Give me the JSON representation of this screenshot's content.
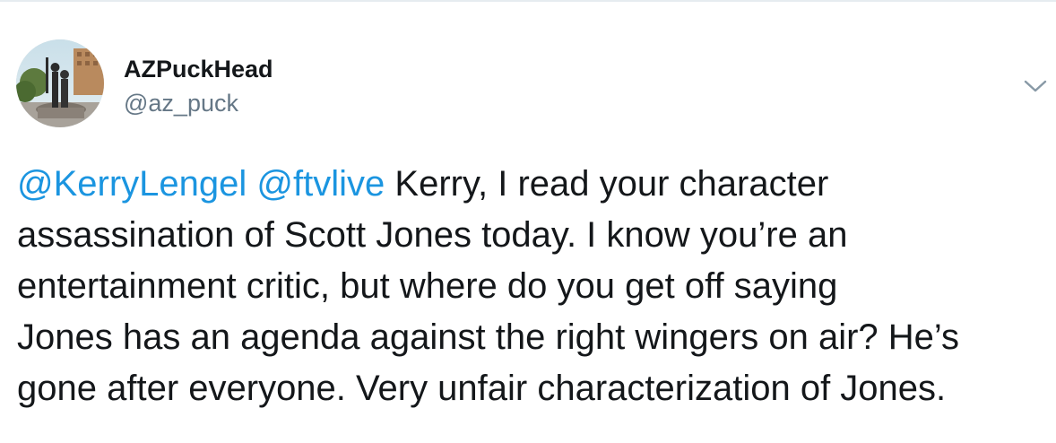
{
  "tweet": {
    "author": {
      "display_name": "AZPuckHead",
      "handle": "@az_puck",
      "avatar_icon": "statue-avatar-photo"
    },
    "menu_icon": "chevron-down-icon",
    "mentions": [
      "@KerryLengel",
      "@ftvlive"
    ],
    "text_lines": [
      "Kerry, I read your character",
      "assassination of Scott Jones today. I know you’re an",
      "entertainment critic, but where do you get off saying",
      "Jones has an agenda against the right wingers on air? He’s",
      "gone after everyone. Very unfair characterization of Jones."
    ]
  },
  "colors": {
    "link": "#1b95e0",
    "text": "#14171a",
    "secondary": "#657786",
    "border": "#e6ecf0"
  }
}
